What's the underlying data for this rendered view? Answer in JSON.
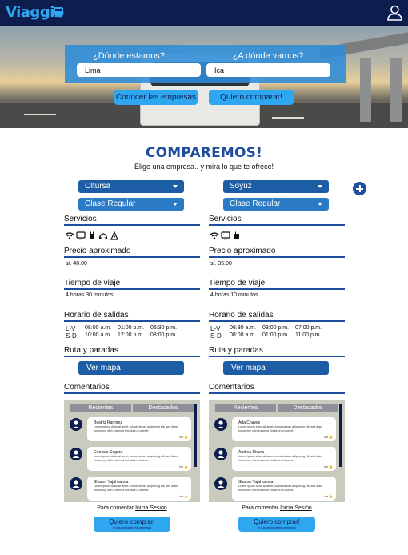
{
  "app": {
    "logo_text": "Viaggio"
  },
  "search": {
    "from_label": "¿Dónde estamos?",
    "from_value": "Lima",
    "to_label": "¿A dónde vamos?",
    "to_value": "Ica",
    "companies_button": "Conocer las empresas",
    "compare_button": "Quiero comparar!"
  },
  "compare": {
    "title": "COMPAREMOS!",
    "subtitle": "Elige una empresa.. y mira lo que te ofrece!"
  },
  "columns": [
    {
      "company": "Oltursa",
      "class": "Clase Regular",
      "services_label": "Servicios",
      "service_icons": [
        "wifi-icon",
        "tv-icon",
        "power-plug-icon",
        "headphones-icon",
        "food-icon"
      ],
      "price_label": "Precio aproximado",
      "price": "s/. 40.00",
      "time_label": "Tiempo de viaje",
      "time": "4 horas 30 minutos",
      "schedule_label": "Horario de salidas",
      "schedule": [
        {
          "days": "L-V",
          "times": [
            "08:00 a.m.",
            "01:00 p.m.",
            "06:30 p.m."
          ]
        },
        {
          "days": "S-D",
          "times": [
            "10:00 a.m.",
            "12:00 p.m.",
            "08:00 p.m."
          ]
        }
      ],
      "route_label": "Ruta y  paradas",
      "map_button": "Ver mapa",
      "comments_label": "Comentarios",
      "tabs": [
        "Recientes",
        "Destacados"
      ],
      "comments": [
        {
          "name": "Beatriz Ramírez",
          "text": "Lorem ipsum dolor sit amet, consectetuer adipiscing elit, sed diam nonummy nibh euismod tincidunt ut laoreet",
          "likes": "ice"
        },
        {
          "name": "Gonzalo Segura",
          "text": "Lorem ipsum dolor sit amet, consectetuer adipiscing elit, sed diam nonummy nibh euismod tincidunt ut laoreet",
          "likes": "ice"
        },
        {
          "name": "Sharon Yajahuanca",
          "text": "Lorem ipsum dolor sit amet, consectetuer adipiscing elit, sed diam nonummy nibh euismod tincidunt ut laoreet",
          "likes": "ice"
        }
      ],
      "login_prefix": "Para comentar",
      "login_link": "Inicia Sesión",
      "buy_button": "Quiero comprar!",
      "buy_sub": "(ir a la página de esta empresa)"
    },
    {
      "company": "Soyuz",
      "class": "Clase Regular",
      "services_label": "Servicios",
      "service_icons": [
        "wifi-icon",
        "tv-icon",
        "power-plug-icon"
      ],
      "price_label": "Precio aproximado",
      "price": "s/. 35.00",
      "time_label": "Tiempo de viaje",
      "time": "4 horas 10 minutos",
      "schedule_label": "Horario de salidas",
      "schedule": [
        {
          "days": "L-V",
          "times": [
            "06:30 a.m.",
            "03:00 p.m.",
            "07:00 p.m."
          ]
        },
        {
          "days": "S-D",
          "times": [
            "08:00 a.m.",
            "01:00 p.m.",
            "11:00 p.m."
          ]
        }
      ],
      "route_label": "Ruta y  paradas",
      "map_button": "Ver mapa",
      "comments_label": "Comentarios",
      "tabs": [
        "Recientes",
        "Destacados"
      ],
      "comments": [
        {
          "name": "Ada Chavez",
          "text": "Lorem ipsum dolor sit amet, consectetuer adipiscing elit, sed diam nonummy nibh euismod tincidunt ut laoreet",
          "likes": "ice"
        },
        {
          "name": "Andrea Rivera",
          "text": "Lorem ipsum dolor sit amet, consectetuer adipiscing elit, sed diam nonummy nibh euismod tincidunt ut laoreet",
          "likes": "ice"
        },
        {
          "name": "Sharon Yajahuanca",
          "text": "Lorem ipsum dolor sit amet, consectetuer adipiscing elit, sed diam nonummy nibh euismod tincidunt ut laoreet",
          "likes": "ice"
        }
      ],
      "login_prefix": "Para comentar",
      "login_link": "Inicia Sesión",
      "buy_button": "Quiero comprar!",
      "buy_sub": "(ir a la página de esta empresa)"
    }
  ],
  "colors": {
    "header": "#0c1d4e",
    "accent": "#2fa6f0",
    "primary": "#1d4f9e",
    "select": "#1c5da6"
  }
}
